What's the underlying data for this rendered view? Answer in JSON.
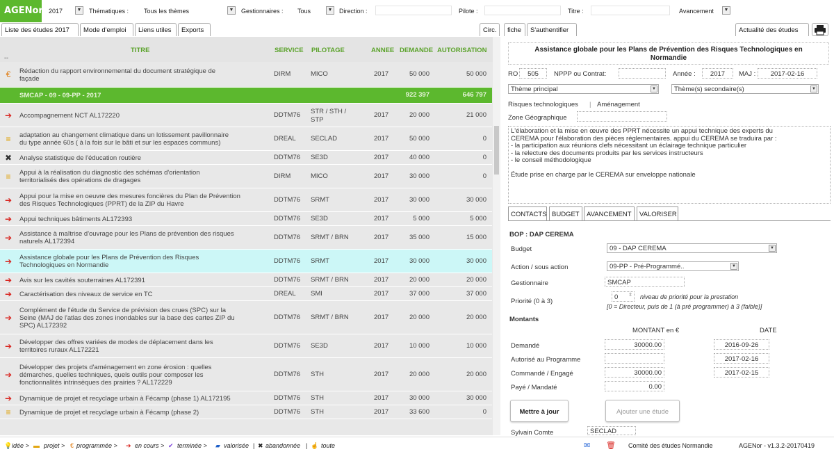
{
  "app": {
    "logo": "AGENor",
    "version": "AGENor - v1.3.2-20170419",
    "footer_center": "Comité des études Normandie"
  },
  "filters": {
    "year": "2017",
    "thematiques_label": "Thématiques :",
    "thematiques_value": "Tous les thèmes",
    "gestionnaires_label": "Gestionnaires :",
    "gestionnaires_value": "Tous",
    "direction_label": "Direction :",
    "pilote_label": "Pilote :",
    "titre_label": "Titre :",
    "avancement_label": "Avancement"
  },
  "tabs": {
    "liste": "Liste des études 2017",
    "mode": "Mode d'emploi",
    "liens": "Liens utiles",
    "exports": "Exports",
    "circ": "Circ.",
    "fiche": "fiche",
    "auth": "S'authentifier",
    "actualite": "Actualité des études"
  },
  "table": {
    "headers": {
      "titre": "TITRE",
      "service": "SERVICE",
      "pilotage": "PILOTAGE",
      "annee": "ANNEE",
      "demande": "DEMANDE",
      "autorisation": "AUTORISATION"
    },
    "top_marker": "--",
    "rows": [
      {
        "icon": "€",
        "titre1": "Rédaction du rapport environnemental du document stratégique de",
        "titre2": "façade",
        "service": "DIRM",
        "pilotage": "MICO",
        "annee": "2017",
        "demande": "50 000",
        "autorisation": "50 000"
      },
      {
        "icon": "",
        "titre1": "SMCAP - 09 - 09-PP - 2017",
        "titre2": "",
        "service": "",
        "pilotage": "",
        "annee": "",
        "demande": "922 397",
        "autorisation": "646 797"
      },
      {
        "icon": "➔",
        "titre1": "Accompagnement NCT AL172220",
        "titre2": "",
        "service": "DDTM76",
        "pilotage": "STR / STH /",
        "pilotage2": "STP",
        "annee": "2017",
        "demande": "20 000",
        "autorisation": "21 000"
      },
      {
        "icon": "≡",
        "titre1": "adaptation au changement climatique dans un lotissement pavillonnaire",
        "titre2": "du type année 60s ( à la fois sur le bâti et sur les espaces communs)",
        "service": "DREAL",
        "pilotage": "SECLAD",
        "annee": "2017",
        "demande": "50 000",
        "autorisation": "0"
      },
      {
        "icon": "✖",
        "titre1": "Analyse statistique de l'éducation routière",
        "titre2": "",
        "service": "DDTM76",
        "pilotage": "SE3D",
        "annee": "2017",
        "demande": "40 000",
        "autorisation": "0"
      },
      {
        "icon": "≡",
        "titre1": "Appui à la réalisation du diagnostic des schémas d'orientation",
        "titre2": "territorialisés des opérations de dragages",
        "service": "DIRM",
        "pilotage": "MICO",
        "annee": "2017",
        "demande": "30 000",
        "autorisation": "0"
      },
      {
        "icon": "➔",
        "titre1": "Appui pour la mise en oeuvre des mesures foncières du Plan de Prévention",
        "titre2": "des Risques Technologiques (PPRT) de la ZIP du Havre",
        "service": "DDTM76",
        "pilotage": "SRMT",
        "annee": "2017",
        "demande": "30 000",
        "autorisation": "30 000"
      },
      {
        "icon": "➔",
        "titre1": "Appui techniques bâtiments AL172393",
        "titre2": "",
        "service": "DDTM76",
        "pilotage": "SE3D",
        "annee": "2017",
        "demande": "5 000",
        "autorisation": "5 000"
      },
      {
        "icon": "➔",
        "titre1": "Assistance à maîtrise d'ouvrage pour les Plans de prévention des risques",
        "titre2": "naturels AL172394",
        "service": "DDTM76",
        "pilotage": "SRMT / BRN",
        "annee": "2017",
        "demande": "35 000",
        "autorisation": "15 000"
      },
      {
        "icon": "➔",
        "titre1": "Assistance globale pour les Plans de Prévention des Risques",
        "titre2": "Technologiques en Normandie",
        "service": "DDTM76",
        "pilotage": "SRMT",
        "annee": "2017",
        "demande": "30 000",
        "autorisation": "30 000"
      },
      {
        "icon": "➔",
        "titre1": "Avis sur les cavités souterraines AL172391",
        "titre2": "",
        "service": "DDTM76",
        "pilotage": "SRMT / BRN",
        "annee": "2017",
        "demande": "20 000",
        "autorisation": "20 000"
      },
      {
        "icon": "➔",
        "titre1": "Caractérisation des niveaux de service en TC",
        "titre2": "",
        "service": "DREAL",
        "pilotage": "SMI",
        "annee": "2017",
        "demande": "37 000",
        "autorisation": "37 000"
      },
      {
        "icon": "➔",
        "titre1": "Complément de l'étude du Service de prévision des crues (SPC) sur la",
        "titre2": "Seine (MAJ de l'atlas des zones inondables sur la base des cartes ZIP du",
        "titre3": "SPC) AL172392",
        "service": "DDTM76",
        "pilotage": "SRMT / BRN",
        "annee": "2017",
        "demande": "20 000",
        "autorisation": "20 000"
      },
      {
        "icon": "➔",
        "titre1": "Développer des offres variées de modes de déplacement dans les",
        "titre2": "territoires ruraux AL172221",
        "service": "DDTM76",
        "pilotage": "SE3D",
        "annee": "2017",
        "demande": "10 000",
        "autorisation": "10 000"
      },
      {
        "icon": "➔",
        "titre1": "Développer des projets d'aménagement en zone érosion : quelles",
        "titre2": "démarches, quelles techniques, quels outils pour composer les",
        "titre3": "fonctionnalités intrinsèques des prairies ? AL172229",
        "service": "DDTM76",
        "pilotage": "STH",
        "annee": "2017",
        "demande": "20 000",
        "autorisation": "20 000"
      },
      {
        "icon": "➔",
        "titre1": "Dynamique de projet et recyclage urbain à Fécamp (phase 1) AL172195",
        "titre2": "",
        "service": "DDTM76",
        "pilotage": "STH",
        "annee": "2017",
        "demande": "30 000",
        "autorisation": "30 000"
      },
      {
        "icon": "≡",
        "titre1": "Dynamique de projet et recyclage urbain à Fécamp (phase 2)",
        "titre2": "",
        "service": "DDTM76",
        "pilotage": "STH",
        "annee": "2017",
        "demande": "33 600",
        "autorisation": "0"
      }
    ]
  },
  "detail": {
    "title1": "Assistance globale pour les Plans de Prévention des Risques Technologiques en",
    "title2": "Normandie",
    "ro_label": "RO :",
    "ro_value": "505",
    "nppp_label": "NPPP ou Contrat:",
    "annee_label": "Année :",
    "annee_value": "2017",
    "maj_label": "MAJ :",
    "maj_value": "2017-02-16",
    "theme_principal": "Thème principal",
    "themes_secondaires": "Thème(s) secondaire(s)",
    "theme1": "Risques technologiques",
    "theme2": "Aménagement",
    "zone_label": "Zone Géographique",
    "description": [
      "L'élaboration et la mise en œuvre des PPRT nécessite un appui technique des experts du",
      "CEREMA pour l'élaboration des pièces réglementaires. appui du CEREMA se traduira par :",
      "- la participation aux réunions clefs nécessitant un éclairage technique particulier",
      "- la relecture des documents produits par les services instructeurs",
      "- le conseil méthodologique",
      "",
      "Étude prise en charge par le CEREMA sur enveloppe nationale"
    ],
    "tabs": {
      "contacts": "CONTACTS",
      "budget": "BUDGET",
      "avancement": "AVANCEMENT",
      "valoriser": "VALORISER"
    },
    "bop_title": "BOP : DAP CEREMA",
    "budget_label": "Budget",
    "budget_value": "09 - DAP CEREMA",
    "action_label": "Action / sous action",
    "action_value": "09-PP - Pré-Programmé..",
    "gestionnaire_label": "Gestionnaire",
    "gestionnaire_value": "SMCAP",
    "priorite_label": "Priorité (0 à 3)",
    "priorite_value": "0",
    "priorite_hint1": "niveau de priorité pour la prestation",
    "priorite_hint2": "[0 = Directeur, puis de 1 (à pré programmer) à 3 (faible)]",
    "montants_title": "Montants",
    "montant_col": "MONTANT en €",
    "date_col": "DATE",
    "lines": [
      {
        "label": "Demandé",
        "montant": "30000.00",
        "date": "2016-09-26"
      },
      {
        "label": "Autorisé au Programme",
        "montant": "",
        "date": "2017-02-16"
      },
      {
        "label": "Commandé / Engagé",
        "montant": "30000.00",
        "date": "2017-02-15"
      },
      {
        "label": "Payé / Mandaté",
        "montant": "0.00",
        "date": ""
      }
    ],
    "btn_update": "Mettre à jour",
    "btn_add": "Ajouter une étude",
    "user_name": "Sylvain Comte",
    "user_service": "SECLAD"
  },
  "legend": {
    "idee": "idée >",
    "projet": "projet >",
    "programmee": "programmée >",
    "encours": "en cours >",
    "terminee": "terminée >",
    "valorisee": "valorisée",
    "abandonnee": "abandonnée",
    "toute": "toute"
  },
  "colors": {
    "brand": "#5cb82e",
    "arrow": "#d8231e",
    "euro": "#e07b10",
    "highlight": "#ccf7f7"
  }
}
